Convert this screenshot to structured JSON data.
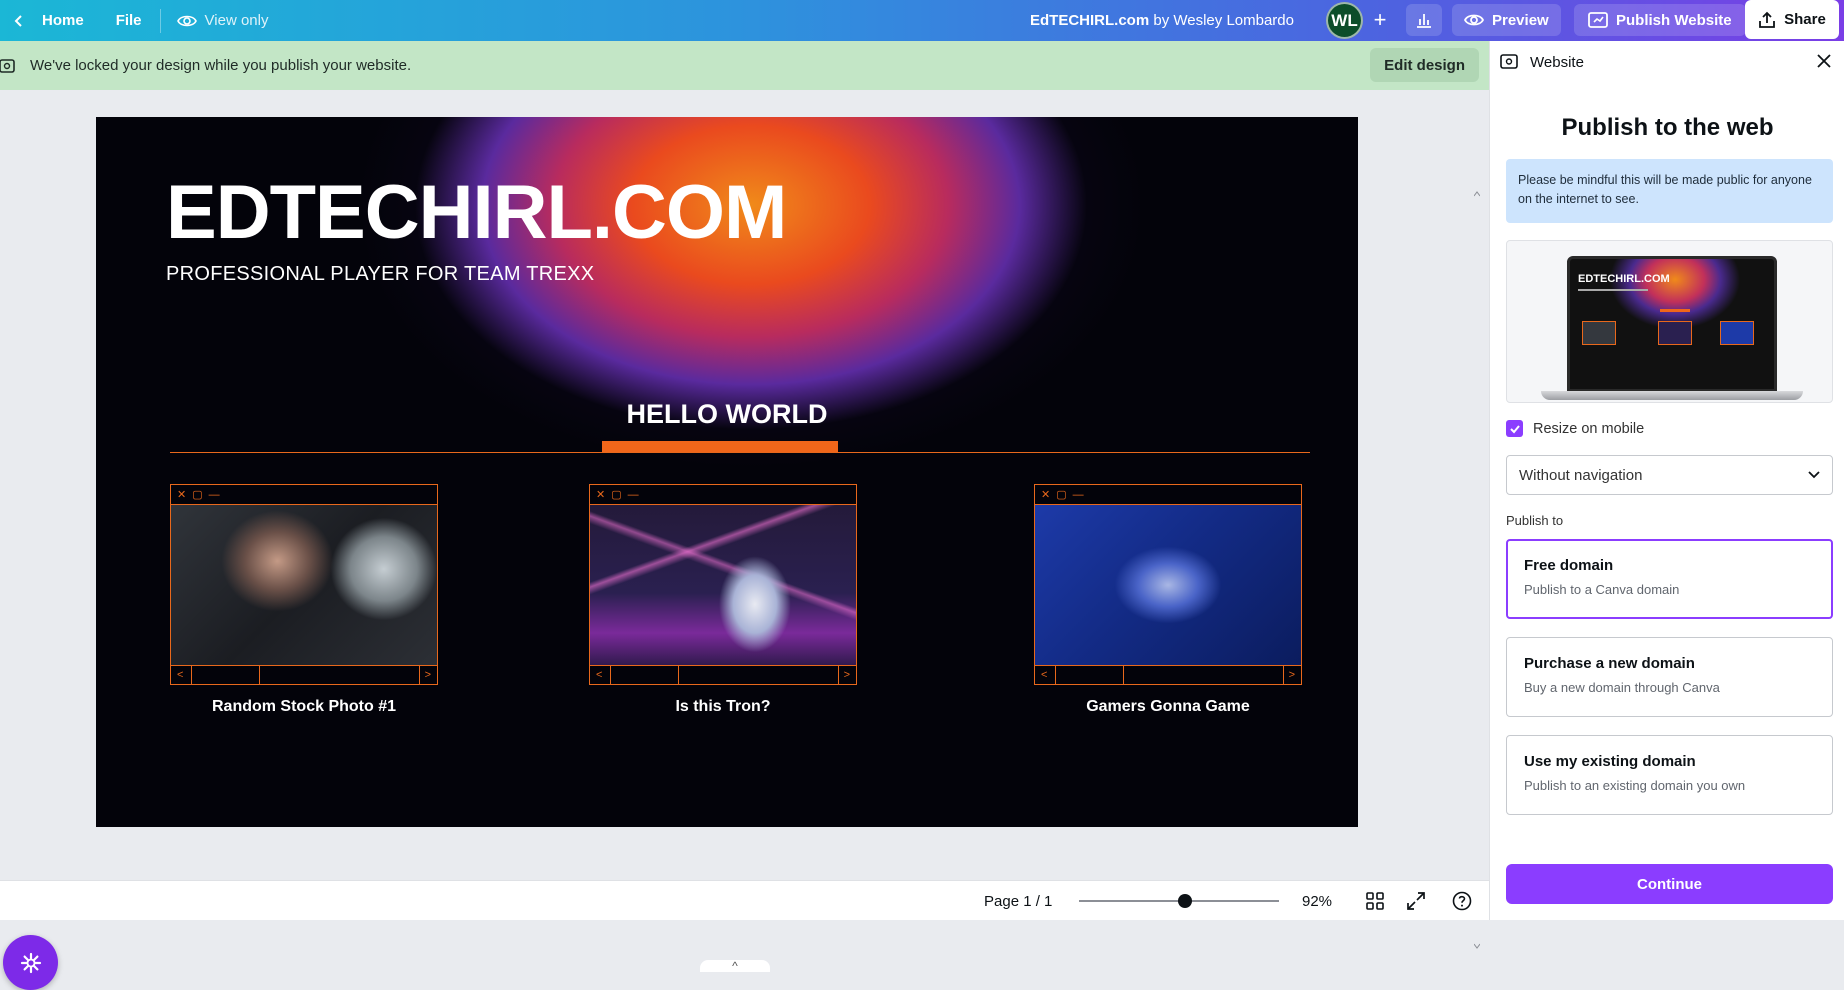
{
  "topbar": {
    "home_label": "Home",
    "file_label": "File",
    "view_only_label": "View only",
    "doc_title": "EdTECHIRL.com",
    "doc_by": "by Wesley Lombardo",
    "avatar_initials": "WL",
    "preview_label": "Preview",
    "publish_label": "Publish Website",
    "share_label": "Share"
  },
  "banner": {
    "text": "We've locked your design while you publish your website.",
    "edit_label": "Edit design"
  },
  "design": {
    "title": "EDTECHIRL.COM",
    "subtitle": "PROFESSIONAL PLAYER FOR TEAM TREXX",
    "section_heading": "HELLO WORLD",
    "cards": [
      {
        "caption": "Random Stock Photo #1"
      },
      {
        "caption": "Is this Tron?"
      },
      {
        "caption": "Gamers Gonna Game"
      }
    ]
  },
  "footer": {
    "page_label": "Page 1 / 1",
    "zoom_percent": 92,
    "zoom_label": "92%"
  },
  "panel": {
    "header_label": "Website",
    "title": "Publish to the web",
    "notice": "Please be mindful this will be made public for anyone on the internet to see.",
    "preview_title": "EDTECHIRL.COM",
    "resize_label": "Resize on mobile",
    "resize_checked": true,
    "navigation_value": "Without navigation",
    "publish_to_label": "Publish to",
    "options": [
      {
        "title": "Free domain",
        "subtitle": "Publish to a Canva domain",
        "selected": true
      },
      {
        "title": "Purchase a new domain",
        "subtitle": "Buy a new domain through Canva",
        "selected": false
      },
      {
        "title": "Use my existing domain",
        "subtitle": "Publish to an existing domain you own",
        "selected": false
      }
    ],
    "continue_label": "Continue"
  },
  "colors": {
    "accent": "#8b3dff",
    "design_orange": "#e8681c",
    "banner_green": "#c3e6c6",
    "notice_blue": "#cde4fd"
  }
}
